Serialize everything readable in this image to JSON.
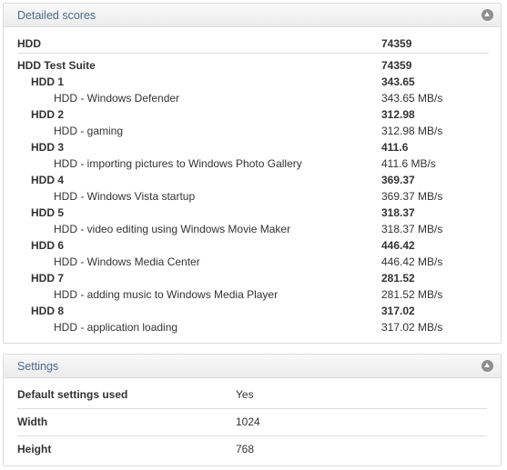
{
  "scores": {
    "title": "Detailed scores",
    "total_label": "HDD",
    "total_value": "74359",
    "suite_label": "HDD Test Suite",
    "suite_value": "74359",
    "tests": [
      {
        "label": "HDD 1",
        "value": "343.65",
        "sub_label": "HDD - Windows Defender",
        "sub_value": "343.65 MB/s"
      },
      {
        "label": "HDD 2",
        "value": "312.98",
        "sub_label": "HDD - gaming",
        "sub_value": "312.98 MB/s"
      },
      {
        "label": "HDD 3",
        "value": "411.6",
        "sub_label": "HDD - importing pictures to Windows Photo Gallery",
        "sub_value": "411.6 MB/s"
      },
      {
        "label": "HDD 4",
        "value": "369.37",
        "sub_label": "HDD - Windows Vista startup",
        "sub_value": "369.37 MB/s"
      },
      {
        "label": "HDD 5",
        "value": "318.37",
        "sub_label": "HDD - video editing using Windows Movie Maker",
        "sub_value": "318.37 MB/s"
      },
      {
        "label": "HDD 6",
        "value": "446.42",
        "sub_label": "HDD - Windows Media Center",
        "sub_value": "446.42 MB/s"
      },
      {
        "label": "HDD 7",
        "value": "281.52",
        "sub_label": "HDD - adding music to Windows Media Player",
        "sub_value": "281.52 MB/s"
      },
      {
        "label": "HDD 8",
        "value": "317.02",
        "sub_label": "HDD - application loading",
        "sub_value": "317.02 MB/s"
      }
    ]
  },
  "settings": {
    "title": "Settings",
    "rows": [
      {
        "key": "Default settings used",
        "value": "Yes"
      },
      {
        "key": "Width",
        "value": "1024"
      },
      {
        "key": "Height",
        "value": "768"
      }
    ]
  },
  "icons": {
    "collapse": "chevron-up-circle-icon"
  },
  "colors": {
    "header_text": "#4a6a8a",
    "icon": "#8f8f8f"
  }
}
